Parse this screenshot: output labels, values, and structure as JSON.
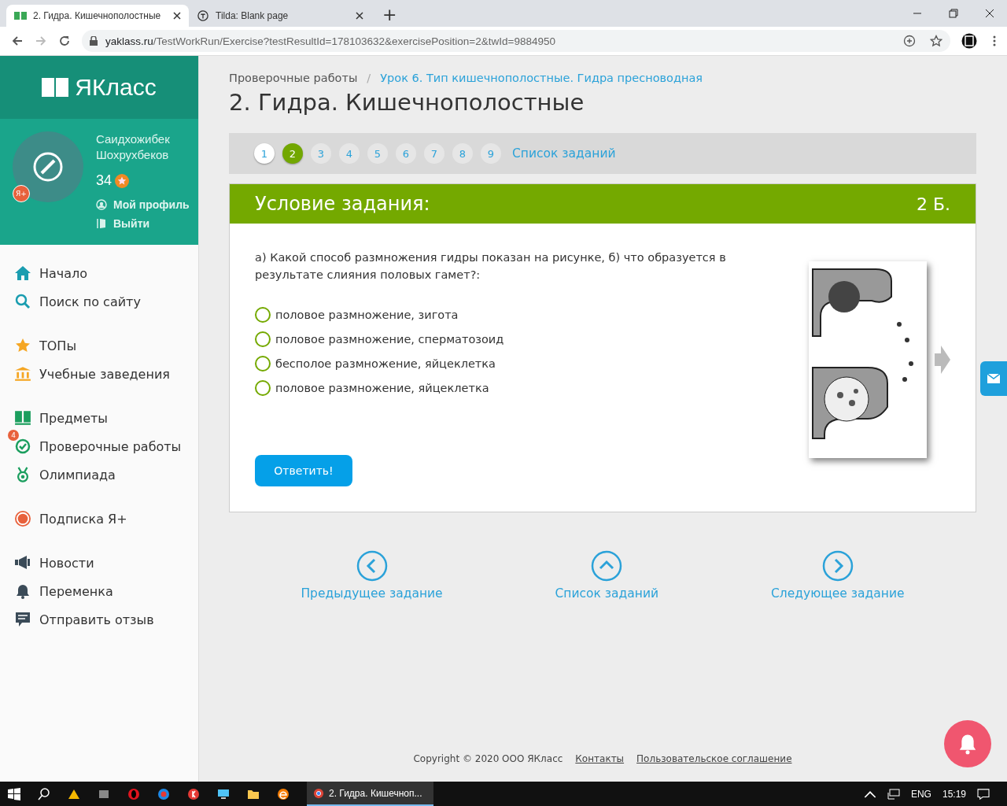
{
  "browser": {
    "tabs": [
      {
        "title": "2. Гидра. Кишечнополостные",
        "selected": true
      },
      {
        "title": "Tilda: Blank page",
        "selected": false
      }
    ],
    "new_tab": "+",
    "address": {
      "host": "yaklass.ru",
      "path": "/TestWorkRun/Exercise?testResultId=178103632&exercisePosition=2&twId=9884950"
    }
  },
  "sidebar": {
    "logo": "ЯКласс",
    "user": {
      "name": "Саидхожибек Шохрухбеков",
      "points": "34",
      "plus_badge": "Я+",
      "links": [
        "Мой профиль",
        "Выйти"
      ]
    },
    "groups": [
      [
        {
          "label": "Начало",
          "kind": "home"
        },
        {
          "label": "Поиск по сайту",
          "kind": "search"
        }
      ],
      [
        {
          "label": "ТОПы",
          "kind": "star"
        },
        {
          "label": "Учебные заведения",
          "kind": "school"
        }
      ],
      [
        {
          "label": "Предметы",
          "kind": "book"
        },
        {
          "label": "Проверочные работы",
          "kind": "check",
          "badge": "4"
        },
        {
          "label": "Олимпиада",
          "kind": "medal"
        }
      ],
      [
        {
          "label": "Подписка Я+",
          "kind": "plus"
        }
      ],
      [
        {
          "label": "Новости",
          "kind": "news"
        },
        {
          "label": "Переменка",
          "kind": "bell"
        },
        {
          "label": "Отправить отзыв",
          "kind": "feedback"
        }
      ]
    ]
  },
  "breadcrumbs": [
    "Проверочные работы",
    "Урок 6. Тип кишечнополостные. Гидра пресноводная"
  ],
  "breadcrumb_separator": "/",
  "title": "2. Гидра. Кишечнополостные",
  "pager": {
    "items": [
      {
        "label": "1",
        "selected": false,
        "visited": true
      },
      {
        "label": "2",
        "selected": true,
        "visited": true
      },
      {
        "label": "3",
        "selected": false,
        "visited": false
      },
      {
        "label": "4",
        "selected": false,
        "visited": false
      },
      {
        "label": "5",
        "selected": false,
        "visited": false
      },
      {
        "label": "6",
        "selected": false,
        "visited": false
      },
      {
        "label": "7",
        "selected": false,
        "visited": false
      },
      {
        "label": "8",
        "selected": false,
        "visited": false
      },
      {
        "label": "9",
        "selected": false,
        "visited": false
      }
    ],
    "list_link": "Список заданий"
  },
  "task": {
    "heading": "Условие задания:",
    "points": "2 Б.",
    "question": "а)  Какой способ размножения гидры показан на рисунке, б)  что образуется в результате слияния половых гамет?:",
    "options": [
      {
        "label": "половое размножение, зигота",
        "selected": false
      },
      {
        "label": "половое размножение, сперматозоид",
        "selected": false
      },
      {
        "label": "бесполое размножение, яйцеклетка",
        "selected": false
      },
      {
        "label": "половое размножение, яйцеклетка",
        "selected": false
      }
    ],
    "submit": "Ответить!"
  },
  "navigation": [
    "Предыдущее задание",
    "Список заданий",
    "Следующее задание"
  ],
  "footer": {
    "copyright": "Copyright © 2020 ООО ЯКласс",
    "links": [
      "Контакты",
      "Пользовательское соглашение"
    ]
  },
  "taskbar": {
    "window": "2. Гидра. Кишечноп...",
    "language": "ENG",
    "time": "15:19"
  }
}
